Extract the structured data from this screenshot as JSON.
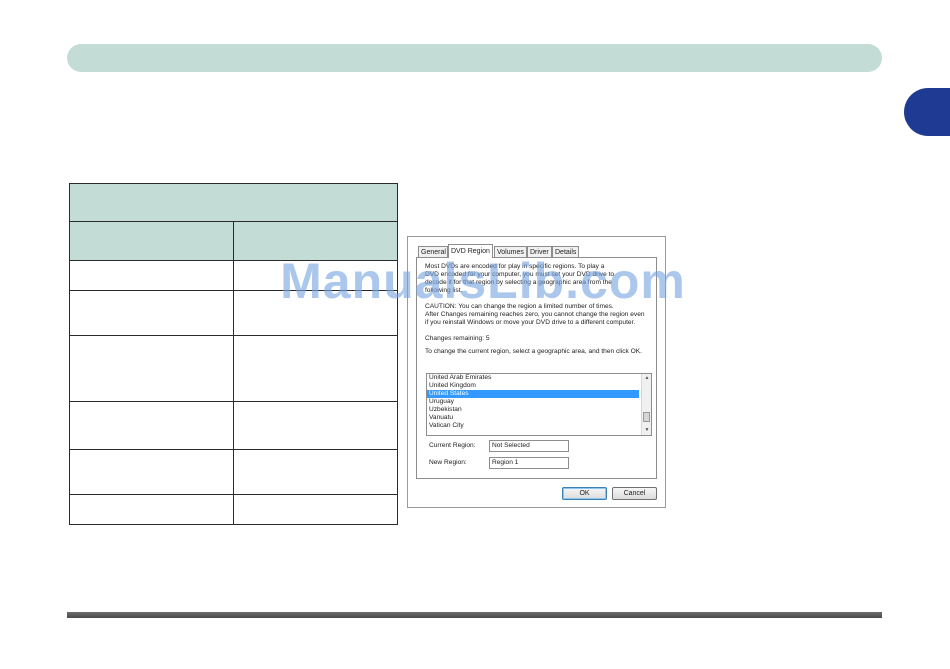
{
  "watermark": "ManualsLib.com",
  "table": {
    "title": "",
    "header": [
      "",
      ""
    ],
    "rows": [
      [
        "",
        ""
      ],
      [
        "",
        ""
      ],
      [
        "",
        ""
      ],
      [
        "",
        ""
      ],
      [
        "",
        ""
      ],
      [
        "",
        ""
      ]
    ]
  },
  "dialog": {
    "tabs": [
      "General",
      "DVD Region",
      "Volumes",
      "Driver",
      "Details"
    ],
    "active_tab": "DVD Region",
    "intro_lines": [
      "Most DVDs are encoded for play in specific regions. To play a",
      "DVD encoded for your computer, you must set your DVD drive to",
      "decode it for that region by selecting a geographic area from the",
      "following list."
    ],
    "caution_lines": [
      "CAUTION: You can change the region a limited number of times.",
      "After Changes remaining reaches zero, you cannot change the region even",
      "if you reinstall Windows or move your DVD drive to a different computer."
    ],
    "changes_remaining": "Changes remaining: 5",
    "instruction": "To change the current region, select a geographic area, and then click OK.",
    "regions": [
      "United Arab Emirates",
      "United Kingdom",
      "United States",
      "Uruguay",
      "Uzbekistan",
      "Vanuatu",
      "Vatican City"
    ],
    "selected_region": "United States",
    "current_region_label": "Current Region:",
    "current_region_value": "Not Selected",
    "new_region_label": "New Region:",
    "new_region_value": "Region 1",
    "ok_label": "OK",
    "cancel_label": "Cancel"
  }
}
